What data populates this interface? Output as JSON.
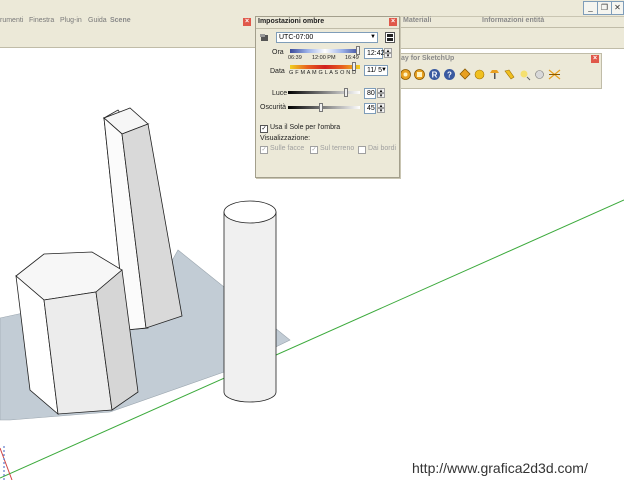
{
  "menubar": {
    "items": [
      "rumenti",
      "Finestra",
      "Plug-in",
      "Guida"
    ]
  },
  "scene_panel": {
    "title": "Scene"
  },
  "side_panels": {
    "materials_title": "Materiali",
    "entity_title": "Informazioni entità"
  },
  "podium_toolbar": {
    "title": "ay for SketchUp",
    "icons": [
      "render-icon",
      "render-options-icon",
      "podium-r-icon",
      "help-icon",
      "tag-icon",
      "sphere-icon",
      "lamp-icon",
      "spotlight-icon",
      "light-icon",
      "bulb-icon",
      "omni-icon"
    ]
  },
  "shadow_dialog": {
    "title": "Impostazioni ombre",
    "timezone": "UTC-07:00",
    "time_label": "Ora",
    "time_marks": [
      "06:39",
      "12:00 PM",
      "16:49"
    ],
    "time_value": "12:42",
    "date_label": "Data",
    "months": "G F M A M G L A S O N D",
    "date_value": "11/ 5",
    "light_label": "Luce",
    "light_value": "80",
    "dark_label": "Oscurità",
    "dark_value": "45",
    "use_sun_label": "Usa il Sole per l'ombra",
    "use_sun_checked": true,
    "display_label": "Visualizzazione:",
    "on_faces_label": "Sulle facce",
    "on_ground_label": "Sul terreno",
    "from_edges_label": "Dai bordi"
  },
  "watermark": "http://www.grafica2d3d.com/",
  "colors": {
    "chrome": "#ece9d8",
    "close_red": "#e0584a",
    "axis_green": "#3caa3c",
    "axis_red": "#d04040",
    "shadow": "#c2ccd5"
  }
}
